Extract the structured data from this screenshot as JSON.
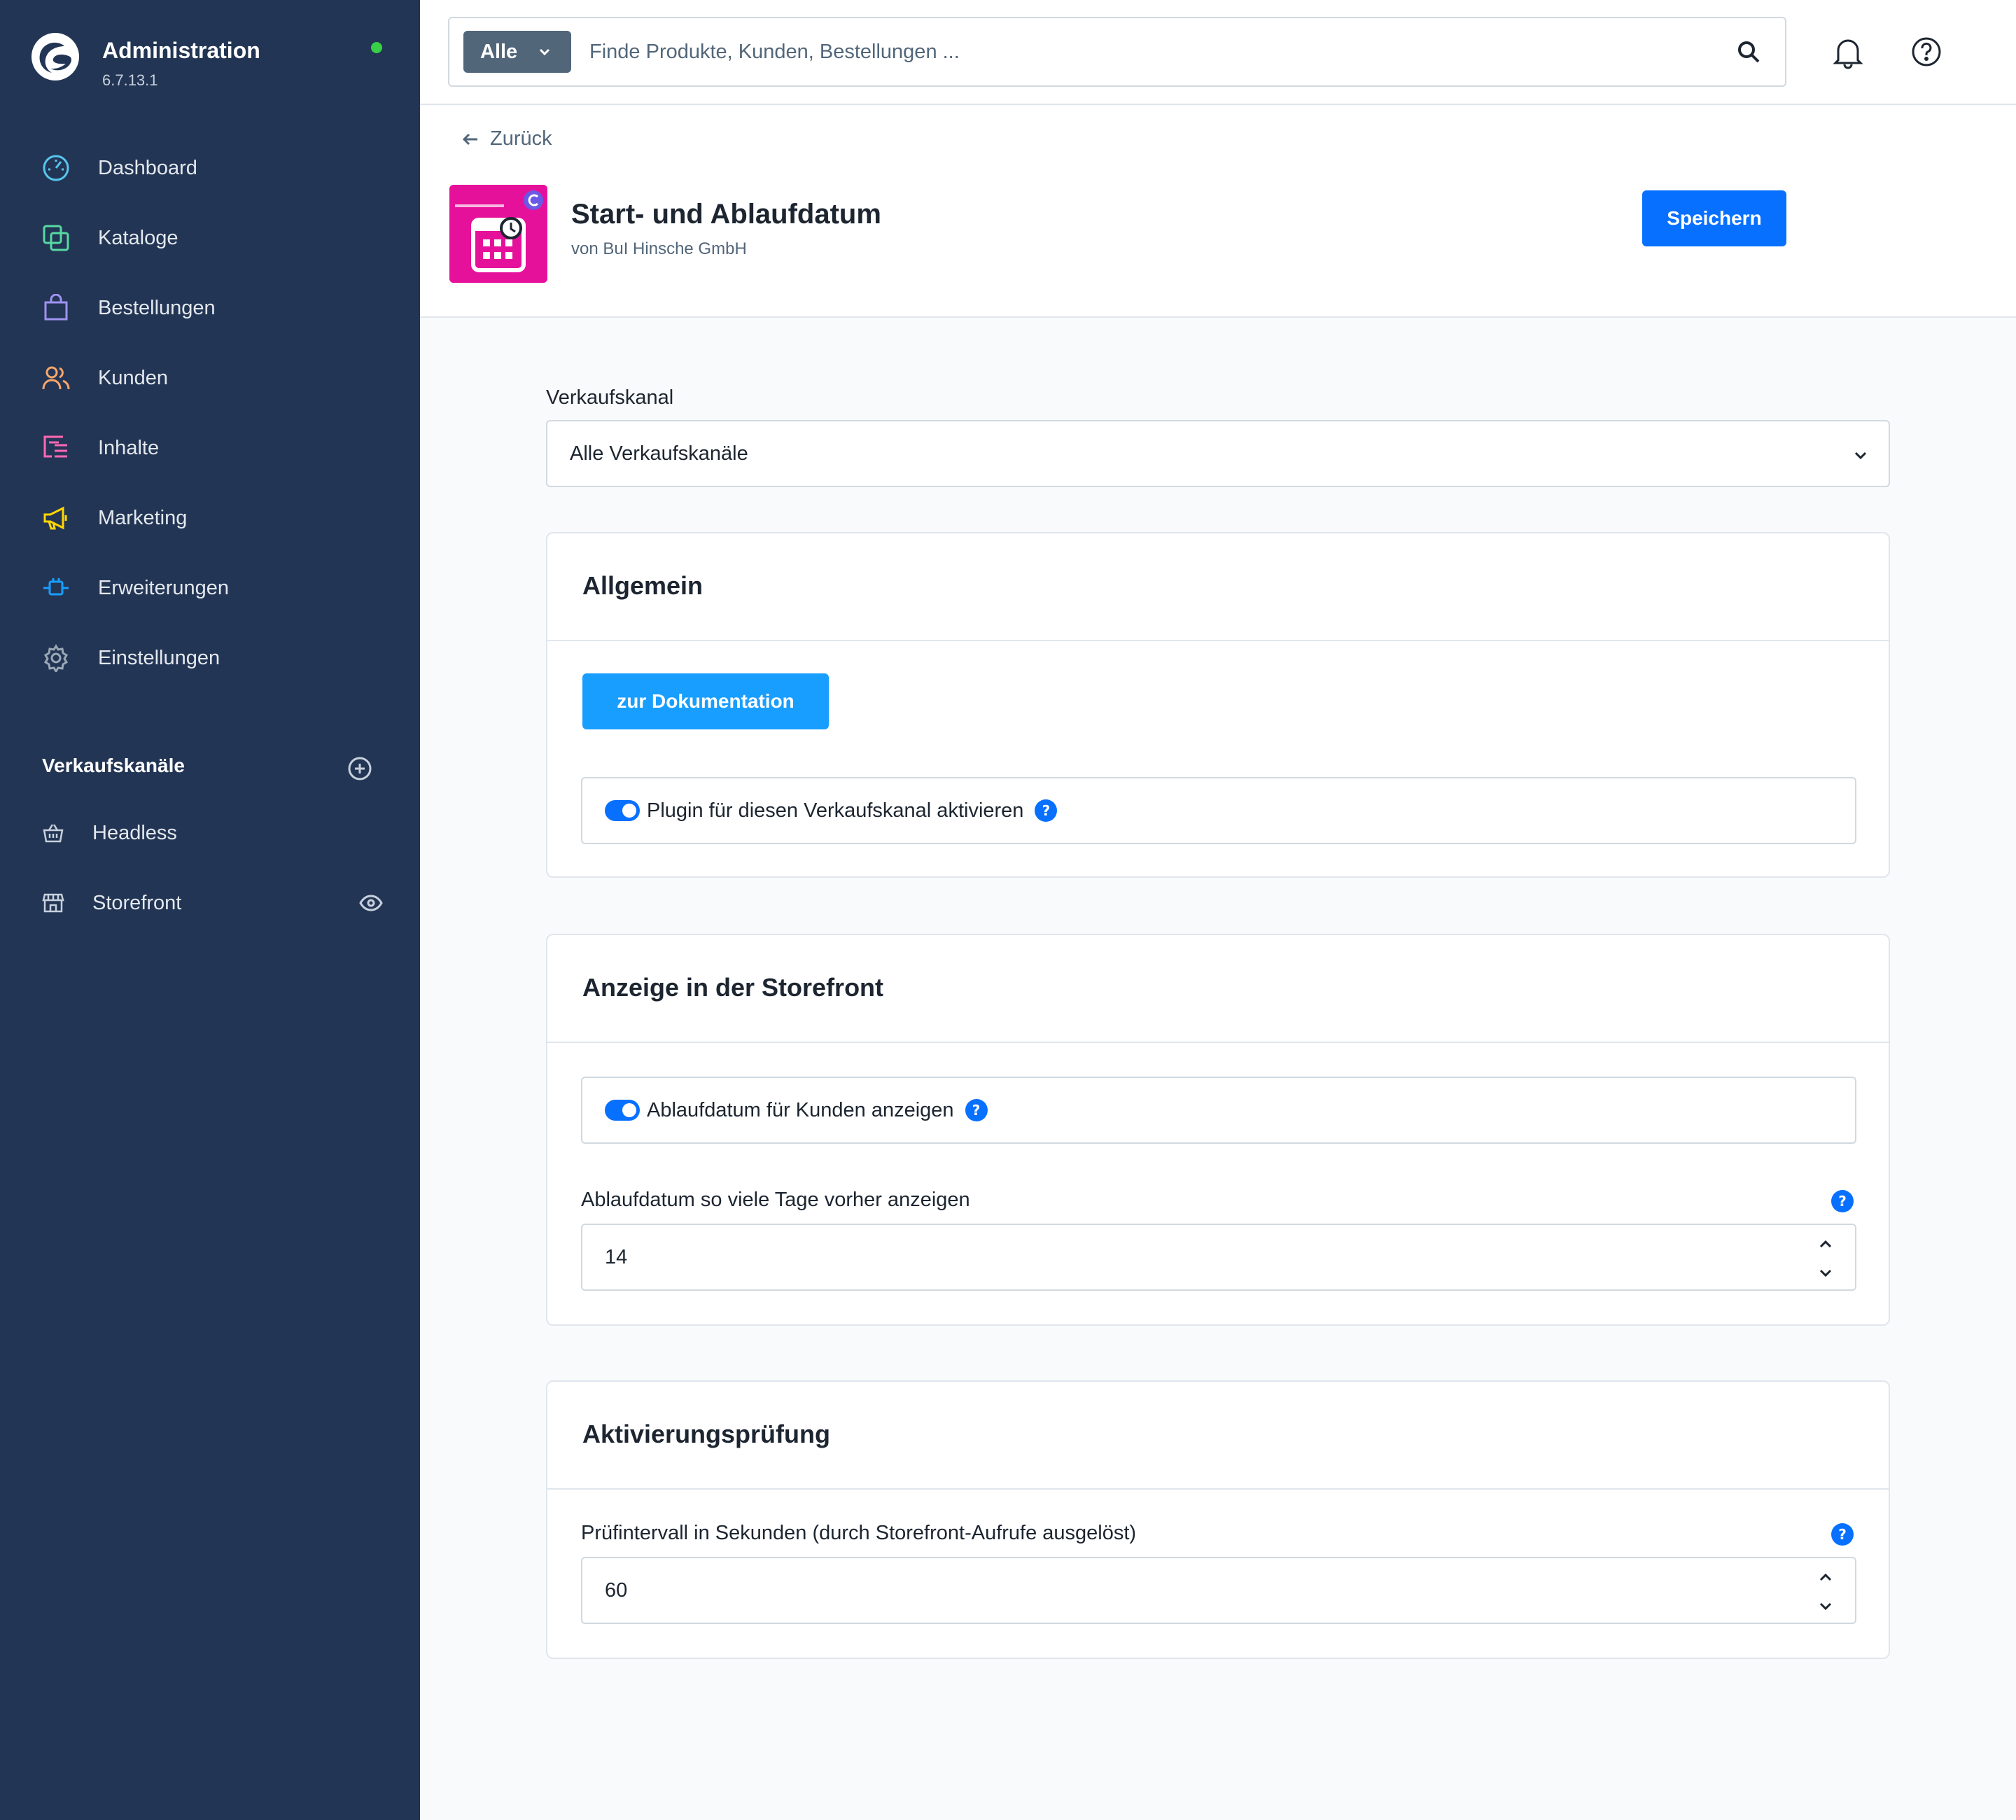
{
  "app": {
    "title": "Administration",
    "version": "6.7.13.1",
    "status_color": "#37d046"
  },
  "sidebar": {
    "items": [
      {
        "label": "Dashboard",
        "icon": "gauge-icon",
        "color": "#56c7f0"
      },
      {
        "label": "Kataloge",
        "icon": "catalog-icon",
        "color": "#57d9a3"
      },
      {
        "label": "Bestellungen",
        "icon": "shopping-bag-icon",
        "color": "#a092f0"
      },
      {
        "label": "Kunden",
        "icon": "users-icon",
        "color": "#f9a76b"
      },
      {
        "label": "Inhalte",
        "icon": "content-icon",
        "color": "#ff68b4"
      },
      {
        "label": "Marketing",
        "icon": "megaphone-icon",
        "color": "#ffd700"
      },
      {
        "label": "Erweiterungen",
        "icon": "plug-icon",
        "color": "#189eff"
      },
      {
        "label": "Einstellungen",
        "icon": "gear-icon",
        "color": "#9aa8b5"
      }
    ],
    "channels_title": "Verkaufskanäle",
    "channels": [
      {
        "label": "Headless",
        "icon": "basket-icon"
      },
      {
        "label": "Storefront",
        "icon": "storefront-icon"
      }
    ]
  },
  "search": {
    "type_label": "Alle",
    "placeholder": "Finde Produkte, Kunden, Bestellungen ..."
  },
  "header": {
    "back_label": "Zurück",
    "plugin_title": "Start- und Ablaufdatum",
    "plugin_author": "von BuI Hinsche GmbH",
    "save_label": "Speichern"
  },
  "sales_channel": {
    "label": "Verkaufskanal",
    "value": "Alle Verkaufskanäle"
  },
  "cards": {
    "general": {
      "title": "Allgemein",
      "doc_button": "zur Dokumentation",
      "toggle_label": "Plugin für diesen Verkaufskanal aktivieren",
      "toggle_on": true
    },
    "storefront": {
      "title": "Anzeige in der Storefront",
      "toggle_label": "Ablaufdatum für Kunden anzeigen",
      "toggle_on": true,
      "days_label": "Ablaufdatum so viele Tage vorher anzeigen",
      "days_value": "14"
    },
    "activation": {
      "title": "Aktivierungsprüfung",
      "interval_label": "Prüfintervall in Sekunden (durch Storefront-Aufrufe ausgelöst)",
      "interval_value": "60"
    }
  },
  "help_glyph": "?",
  "colors": {
    "sidebar_bg": "#233554",
    "primary": "#0870ff",
    "doc_button": "#189eff",
    "plugin_icon_bg": "#e6119a"
  }
}
